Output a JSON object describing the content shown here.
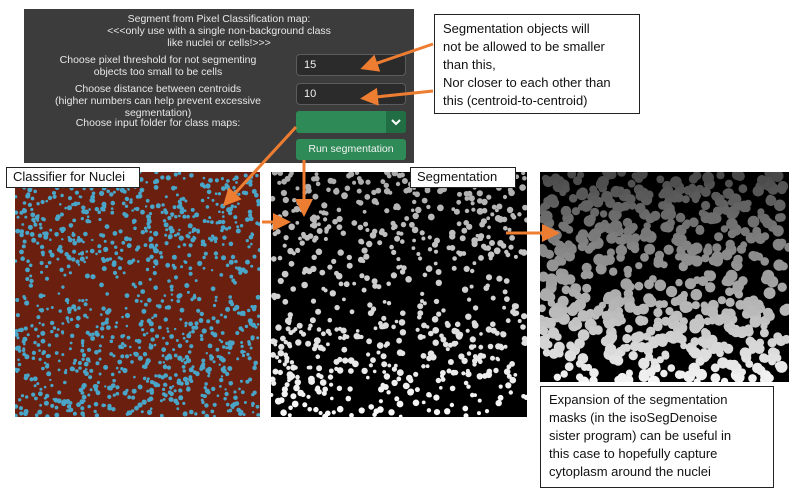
{
  "panel": {
    "heading_line1": "Segment from Pixel Classification map:",
    "heading_line2": "<<<only use with a single non-background class",
    "heading_line3": "like nuclei or cells!>>>",
    "threshold_label_line1": "Choose pixel threshold for not segmenting",
    "threshold_label_line2": "objects too small to be cells",
    "threshold_value": "15",
    "distance_label_line1": "Choose distance between centroids",
    "distance_label_line2": "(higher numbers can help prevent excessive segmentation)",
    "distance_value": "10",
    "folder_label": "Choose input folder for class maps:",
    "run_button": "Run segmentation"
  },
  "notes": {
    "objects_note": [
      "Segmentation objects will",
      "not be allowed to be smaller",
      "than this,",
      "Nor closer to each other than",
      "this (centroid-to-centroid)"
    ],
    "expansion_note": [
      "Expansion of the segmentation",
      "masks (in the isoSegDenoise",
      "sister program) can be useful in",
      "this case to hopefully capture",
      "cytoplasm around the nuclei"
    ]
  },
  "labels": {
    "classifier": "Classifier for Nuclei",
    "segmentation": "Segmentation"
  },
  "colors": {
    "accent_orange": "#ed7d31",
    "button_green": "#2e8b57",
    "panel_dark": "#3c3c3c",
    "classifier_bg": "#6b1f0f",
    "classifier_fg": "#4aa6c8"
  }
}
